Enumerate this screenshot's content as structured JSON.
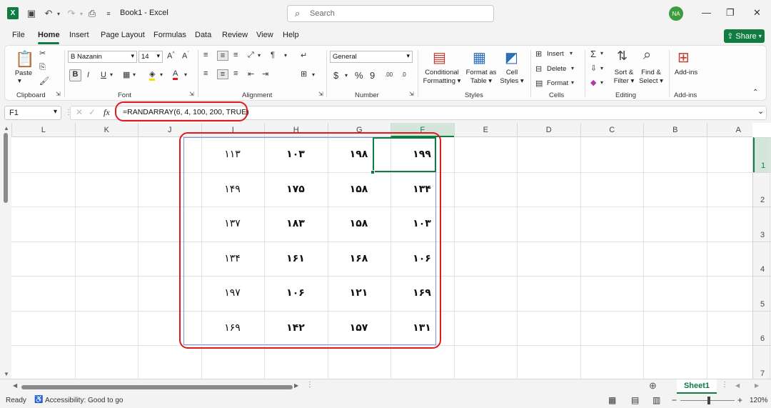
{
  "title_bar": {
    "doc_title": "Book1  -  Excel",
    "search_placeholder": "Search",
    "avatar_initials": "NA"
  },
  "tabs": [
    "File",
    "Home",
    "Insert",
    "Page Layout",
    "Formulas",
    "Data",
    "Review",
    "View",
    "Help"
  ],
  "active_tab": "Home",
  "share_label": "Share",
  "ribbon": {
    "clipboard": {
      "paste": "Paste",
      "label": "Clipboard"
    },
    "font": {
      "name": "B Nazanin",
      "size": "14",
      "bold": "B",
      "italic": "I",
      "underline": "U",
      "label": "Font"
    },
    "alignment": {
      "label": "Alignment"
    },
    "number": {
      "format": "General",
      "label": "Number",
      "currency": "$",
      "percent": "%",
      "comma": "9",
      "inc_decimal": ".00",
      "dec_decimal": ".0"
    },
    "styles": {
      "conditional": [
        "Conditional",
        "Formatting ▾"
      ],
      "format_table": [
        "Format as",
        "Table ▾"
      ],
      "cell_styles": [
        "Cell",
        "Styles ▾"
      ],
      "label": "Styles"
    },
    "cells": {
      "insert": "Insert",
      "delete": "Delete",
      "format": "Format",
      "label": "Cells"
    },
    "editing": {
      "sort": [
        "Sort &",
        "Filter ▾"
      ],
      "find": [
        "Find &",
        "Select ▾"
      ],
      "sum": "Σ",
      "label": "Editing"
    },
    "addins": {
      "button": "Add-ins",
      "label": "Add-ins"
    }
  },
  "formula_bar": {
    "name_box": "F1",
    "fx": "fx",
    "formula": "=RANDARRAY(6, 4, 100, 200, TRUE)"
  },
  "columns": [
    "L",
    "K",
    "J",
    "I",
    "H",
    "G",
    "F",
    "E",
    "D",
    "C",
    "B",
    "A"
  ],
  "rows": [
    "1",
    "2",
    "3",
    "4",
    "5",
    "6",
    "7"
  ],
  "grid_values": [
    [
      "۱۱۳",
      "۱۰۳",
      "۱۹۸",
      "۱۹۹"
    ],
    [
      "۱۴۹",
      "۱۷۵",
      "۱۵۸",
      "۱۳۴"
    ],
    [
      "۱۳۷",
      "۱۸۳",
      "۱۵۸",
      "۱۰۳"
    ],
    [
      "۱۳۴",
      "۱۶۱",
      "۱۶۸",
      "۱۰۶"
    ],
    [
      "۱۹۷",
      "۱۰۶",
      "۱۲۱",
      "۱۶۹"
    ],
    [
      "۱۶۹",
      "۱۴۲",
      "۱۵۷",
      "۱۳۱"
    ]
  ],
  "sheet_tab": "Sheet1",
  "status": {
    "ready": "Ready",
    "accessibility": "Accessibility: Good to go",
    "zoom": "120%"
  },
  "accent_color": "#107c41",
  "highlight_color": "#e0191f"
}
